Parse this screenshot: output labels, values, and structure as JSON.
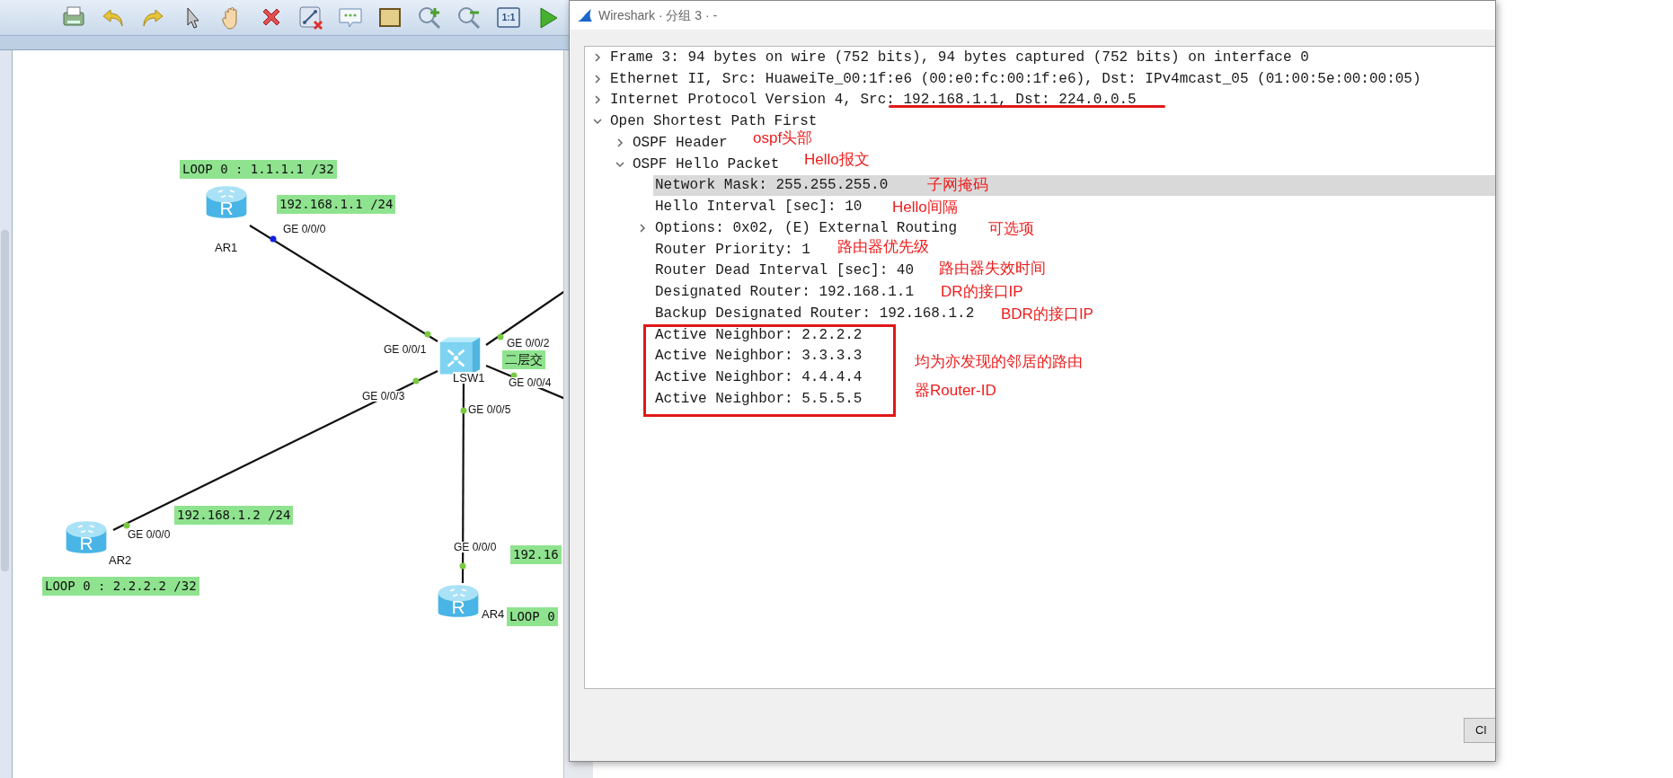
{
  "toolbar": {
    "buttons": [
      {
        "kind": "print"
      },
      {
        "kind": "undo"
      },
      {
        "kind": "redo"
      },
      {
        "kind": "select"
      },
      {
        "kind": "pan"
      },
      {
        "kind": "delete"
      },
      {
        "kind": "unlink"
      },
      {
        "kind": "comment"
      },
      {
        "kind": "rectangle"
      },
      {
        "kind": "zoomin"
      },
      {
        "kind": "zoomout"
      },
      {
        "kind": "actual",
        "text": "1:1"
      },
      {
        "kind": "start"
      }
    ]
  },
  "topology": {
    "devices": [
      {
        "kind": "router",
        "glyph": "R",
        "name": "AR1"
      },
      {
        "kind": "router",
        "glyph": "R",
        "name": "AR2"
      },
      {
        "kind": "switch",
        "name": "LSW1"
      },
      {
        "kind": "router",
        "glyph": "R",
        "name": "AR4"
      }
    ],
    "ports": [
      "GE 0/0/0",
      "GE 0/0/1",
      "GE 0/0/3",
      "GE 0/0/0",
      "GE 0/0/2",
      "GE 0/0/4",
      "GE 0/0/5",
      "GE 0/0/0"
    ],
    "labels": [
      "LOOP 0 : 1.1.1.1 /32",
      "192.168.1.1 /24",
      "二层交",
      "192.168.1.2 /24",
      "LOOP 0 : 2.2.2.2 /32",
      "192.16",
      "LOOP 0"
    ]
  },
  "window": {
    "title": "Wireshark · 分组 3 · -",
    "tree": [
      {
        "text": "Frame 3: 94 bytes on wire (752 bits), 94 bytes captured (752 bits) on interface 0",
        "expanded": false,
        "selected": false
      },
      {
        "text": "Ethernet II, Src: HuaweiTe_00:1f:e6 (00:e0:fc:00:1f:e6), Dst: IPv4mcast_05 (01:00:5e:00:00:05)",
        "expanded": false,
        "selected": false
      },
      {
        "text": "Internet Protocol Version 4, Src: 192.168.1.1, Dst: 224.0.0.5",
        "expanded": false,
        "selected": false
      },
      {
        "text": "Open Shortest Path First",
        "expanded": true,
        "selected": false,
        "children": [
          {
            "text": "OSPF Header",
            "expanded": false,
            "selected": false
          },
          {
            "text": "OSPF Hello Packet",
            "expanded": true,
            "selected": false,
            "children": [
              {
                "text": "Network Mask: 255.255.255.0",
                "selected": true
              },
              {
                "text": "Hello Interval [sec]: 10",
                "selected": false
              },
              {
                "text": "Options: 0x02, (E) External Routing",
                "expanded": false,
                "selected": false
              },
              {
                "text": "Router Priority: 1",
                "selected": false
              },
              {
                "text": "Router Dead Interval [sec]: 40",
                "selected": false
              },
              {
                "text": "Designated Router: 192.168.1.1",
                "selected": false
              },
              {
                "text": "Backup Designated Router: 192.168.1.2",
                "selected": false
              },
              {
                "text": "Active Neighbor: 2.2.2.2",
                "selected": false
              },
              {
                "text": "Active Neighbor: 3.3.3.3",
                "selected": false
              },
              {
                "text": "Active Neighbor: 4.4.4.4",
                "selected": false
              },
              {
                "text": "Active Neighbor: 5.5.5.5",
                "selected": false
              }
            ]
          }
        ]
      }
    ],
    "buttons": [
      "Cl"
    ]
  },
  "annotations": [
    "ospf头部",
    "Hello报文",
    "子网掩码",
    "Hello间隔",
    "可选项",
    "路由器优先级",
    "路由器失效时间",
    "DR的接口IP",
    "BDR的接口IP",
    "均为亦发现的邻居的路由",
    "器Router-ID"
  ]
}
